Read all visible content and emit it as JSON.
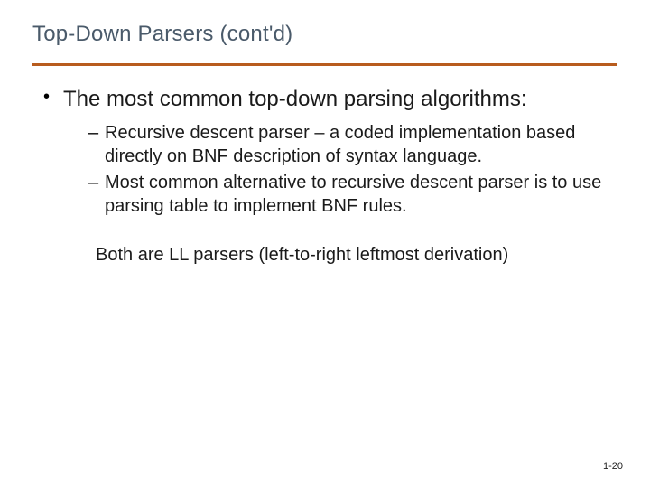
{
  "title": "Top-Down Parsers (cont'd)",
  "colors": {
    "title": "#4a5a6a",
    "rule": "#b85c1e"
  },
  "bullets": {
    "main": "The most common top-down parsing algorithms:",
    "subs": [
      "Recursive descent parser – a coded implementation based directly on BNF description of syntax language.",
      "Most common alternative to recursive descent parser is to use parsing table to implement BNF rules."
    ]
  },
  "closing": "Both are LL parsers (left-to-right leftmost derivation)",
  "page_number": "1-20"
}
